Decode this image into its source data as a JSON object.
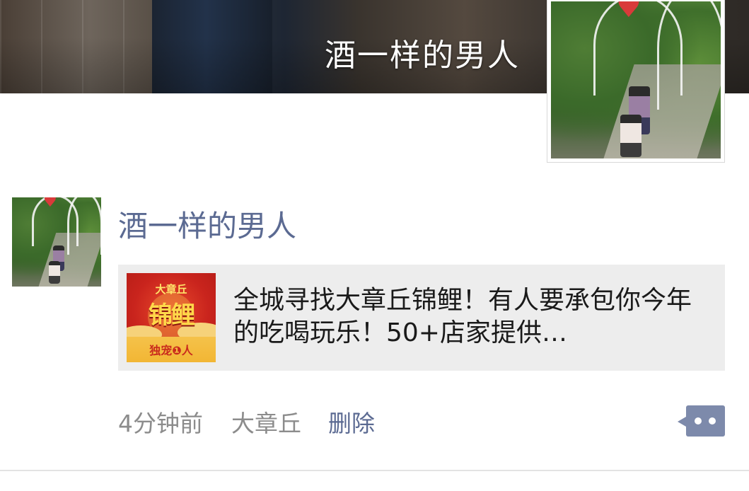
{
  "cover": {
    "name": "酒一样的男人"
  },
  "post": {
    "author": "酒一样的男人",
    "share": {
      "title": "全城寻找大章丘锦鲤！有人要承包你今年的吃喝玩乐！50+店家提供…",
      "thumb_top_text": "大章丘",
      "thumb_big_text": "锦鲤",
      "thumb_badge_text": "独宠❶人"
    },
    "time": "4分钟前",
    "location": "大章丘",
    "delete_label": "删除"
  },
  "colors": {
    "author_link": "#5b6a92",
    "meta_gray": "#8c8c8c",
    "card_bg": "#ededed",
    "more_button": "#7d8aab"
  },
  "icons": {
    "more": "more-dots-icon"
  }
}
